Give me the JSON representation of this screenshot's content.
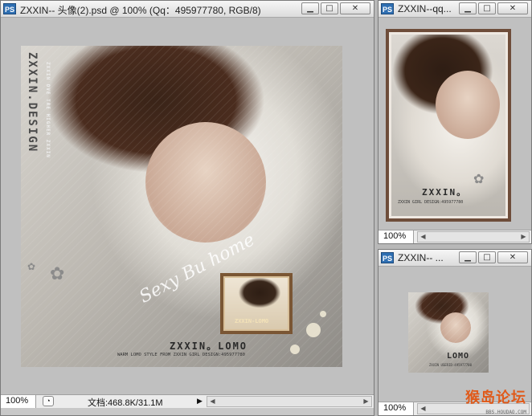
{
  "windows": {
    "main": {
      "title": "ZXXIN-- 头像(2).psd @ 100% (Qq：495977780, RGB/8)",
      "zoom": "100%",
      "doc_info": "文档:468.8K/31.1M",
      "artwork": {
        "vertical_brand": "ZXXIN.DESIGN",
        "vertical_small": "ZXXIN OVE TRE HIGHER ZXXIN",
        "script_text": "Sexy Bu home",
        "inset_label": "ZXXIN-LOMO",
        "main_label": "ZXXIN。LOMO",
        "sub_label": "WARM LOMO STYLE FROM ZXXIN GIRL DESIGN:495977780"
      }
    },
    "top_right": {
      "title": "ZXXIN--qq...",
      "zoom": "100%",
      "artwork": {
        "main_label": "ZXXIN。",
        "sub_label": "ZXXIN GIRL DESIGN:495977780"
      }
    },
    "bottom_right": {
      "title": "ZXXIN-- ...",
      "zoom": "100%",
      "artwork": {
        "main_label": "LOMO",
        "sub_label": "ZXXIN USERID:495977780"
      }
    }
  },
  "watermark": {
    "logo": "猴岛论坛",
    "url": "BBS.HOUDAO.COM"
  },
  "icons": {
    "app": "PS",
    "minimize": "minimize-icon",
    "maximize": "maximize-icon",
    "close": "close-icon"
  }
}
